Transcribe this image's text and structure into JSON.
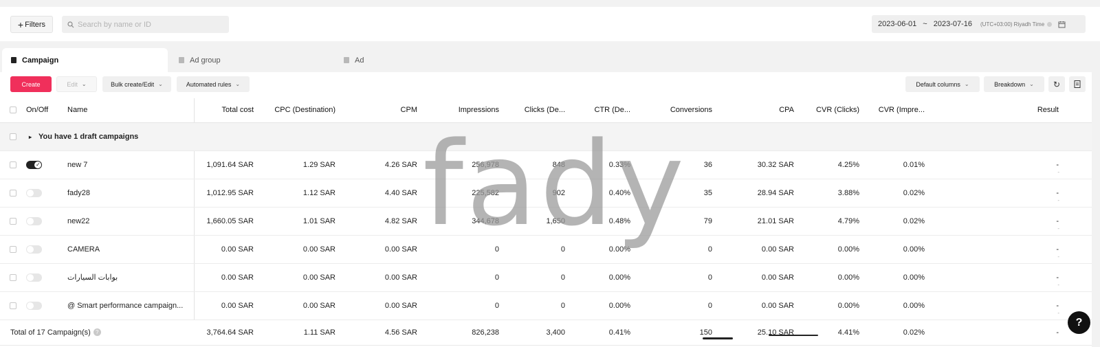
{
  "topbar": {
    "filters_label": "Filters",
    "search_placeholder": "Search by name or ID",
    "date_start": "2023-06-01",
    "date_sep": "~",
    "date_end": "2023-07-16",
    "timezone": "(UTC+03:00) Riyadh Time"
  },
  "tabs": [
    {
      "label": "Campaign",
      "active": true
    },
    {
      "label": "Ad group",
      "active": false
    },
    {
      "label": "Ad",
      "active": false
    }
  ],
  "toolbar": {
    "create_label": "Create",
    "edit_label": "Edit",
    "bulk_label": "Bulk create/Edit",
    "rules_label": "Automated rules",
    "columns_label": "Default columns",
    "breakdown_label": "Breakdown"
  },
  "columns": {
    "onoff": "On/Off",
    "name": "Name",
    "total_cost": "Total cost",
    "cpc": "CPC (Destination)",
    "cpm": "CPM",
    "impressions": "Impressions",
    "clicks": "Clicks (De...",
    "ctr": "CTR (De...",
    "conversions": "Conversions",
    "cpa": "CPA",
    "cvr_clicks": "CVR (Clicks)",
    "cvr_impr": "CVR (Impre...",
    "result": "Result"
  },
  "draft_label": "You have 1 draft campaigns",
  "rows": [
    {
      "on": true,
      "name": "new 7",
      "total_cost": "1,091.64 SAR",
      "cpc": "1.29 SAR",
      "cpm": "4.26 SAR",
      "impressions": "256,978",
      "clicks": "848",
      "ctr": "0.33%",
      "conversions": "36",
      "cpa": "30.32 SAR",
      "cvr_clicks": "4.25%",
      "cvr_impr": "0.01%",
      "result": "-",
      "result_sub": "-"
    },
    {
      "on": false,
      "name": "fady28",
      "total_cost": "1,012.95 SAR",
      "cpc": "1.12 SAR",
      "cpm": "4.40 SAR",
      "impressions": "225,582",
      "clicks": "902",
      "ctr": "0.40%",
      "conversions": "35",
      "cpa": "28.94 SAR",
      "cvr_clicks": "3.88%",
      "cvr_impr": "0.02%",
      "result": "-",
      "result_sub": "-"
    },
    {
      "on": false,
      "name": "new22",
      "total_cost": "1,660.05 SAR",
      "cpc": "1.01 SAR",
      "cpm": "4.82 SAR",
      "impressions": "344,678",
      "clicks": "1,650",
      "ctr": "0.48%",
      "conversions": "79",
      "cpa": "21.01 SAR",
      "cvr_clicks": "4.79%",
      "cvr_impr": "0.02%",
      "result": "-",
      "result_sub": "-"
    },
    {
      "on": false,
      "name": "CAMERA",
      "total_cost": "0.00 SAR",
      "cpc": "0.00 SAR",
      "cpm": "0.00 SAR",
      "impressions": "0",
      "clicks": "0",
      "ctr": "0.00%",
      "conversions": "0",
      "cpa": "0.00 SAR",
      "cvr_clicks": "0.00%",
      "cvr_impr": "0.00%",
      "result": "-",
      "result_sub": "-"
    },
    {
      "on": false,
      "name": "بوابات السيارات",
      "total_cost": "0.00 SAR",
      "cpc": "0.00 SAR",
      "cpm": "0.00 SAR",
      "impressions": "0",
      "clicks": "0",
      "ctr": "0.00%",
      "conversions": "0",
      "cpa": "0.00 SAR",
      "cvr_clicks": "0.00%",
      "cvr_impr": "0.00%",
      "result": "-",
      "result_sub": "-"
    },
    {
      "on": false,
      "name": "@ Smart performance campaign...",
      "total_cost": "0.00 SAR",
      "cpc": "0.00 SAR",
      "cpm": "0.00 SAR",
      "impressions": "0",
      "clicks": "0",
      "ctr": "0.00%",
      "conversions": "0",
      "cpa": "0.00 SAR",
      "cvr_clicks": "0.00%",
      "cvr_impr": "0.00%",
      "result": "-",
      "result_sub": "-"
    }
  ],
  "total": {
    "label": "Total of 17 Campaign(s)",
    "total_cost": "3,764.64 SAR",
    "cpc": "1.11 SAR",
    "cpm": "4.56 SAR",
    "impressions": "826,238",
    "clicks": "3,400",
    "ctr": "0.41%",
    "conversions": "150",
    "cpa": "25.10 SAR",
    "cvr_clicks": "4.41%",
    "cvr_impr": "0.02%",
    "result": "-"
  },
  "help_label": "?",
  "watermark": "fady"
}
